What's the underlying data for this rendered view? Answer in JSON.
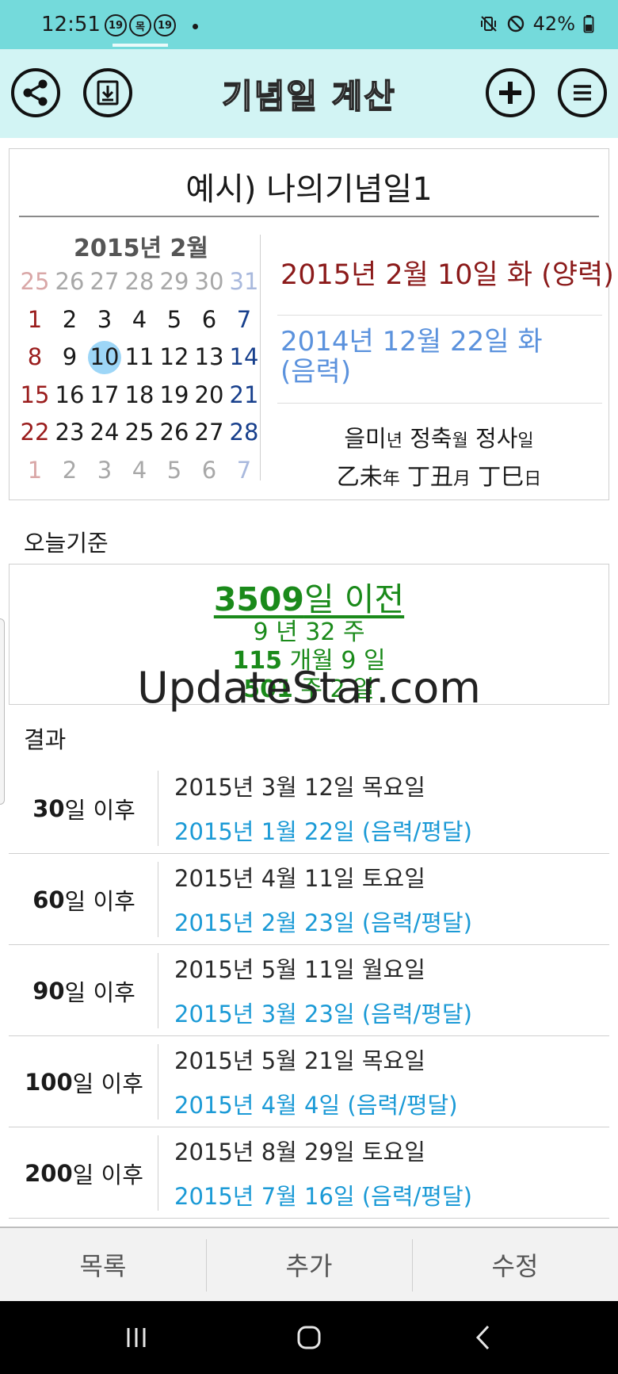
{
  "status_bar": {
    "time": "12:51",
    "badges": [
      "19",
      "목",
      "19"
    ],
    "battery": "42%"
  },
  "app_bar": {
    "title": "기념일 계산",
    "icons": [
      "share-icon",
      "download-icon",
      "add-icon",
      "menu-icon"
    ]
  },
  "anniversary": {
    "title": "예시) 나의기념일1",
    "calendar": {
      "month_label": "2015년 2월",
      "weeks": [
        [
          "25",
          "26",
          "27",
          "28",
          "29",
          "30",
          "31"
        ],
        [
          "1",
          "2",
          "3",
          "4",
          "5",
          "6",
          "7"
        ],
        [
          "8",
          "9",
          "10",
          "11",
          "12",
          "13",
          "14"
        ],
        [
          "15",
          "16",
          "17",
          "18",
          "19",
          "20",
          "21"
        ],
        [
          "22",
          "23",
          "24",
          "25",
          "26",
          "27",
          "28"
        ],
        [
          "1",
          "2",
          "3",
          "4",
          "5",
          "6",
          "7"
        ]
      ],
      "selected_day": "10"
    },
    "solar_date": "2015년 2월 10일 화 (양력)",
    "lunar_date": "2014년 12월 22일 화 (음력)",
    "ganji_korean": [
      {
        "value": "을미",
        "unit": "년"
      },
      {
        "value": "정축",
        "unit": "월"
      },
      {
        "value": "정사",
        "unit": "일"
      }
    ],
    "ganji_hanja": [
      {
        "value": "乙未",
        "unit": "年"
      },
      {
        "value": "丁丑",
        "unit": "月"
      },
      {
        "value": "丁巳",
        "unit": "日"
      }
    ]
  },
  "today": {
    "label": "오늘기준",
    "days_number": "3509",
    "days_suffix": "일 이전",
    "years_weeks": {
      "years": "9",
      "year_unit": " 년 ",
      "weeks": "32",
      "week_unit": " 주"
    },
    "months_days": {
      "months": "115",
      "month_unit": " 개월 ",
      "days": "9",
      "day_unit": " 일"
    },
    "weeks_days": {
      "weeks": "501",
      "week_unit": " 주 ",
      "days": "2",
      "day_unit": " 일"
    }
  },
  "watermark": "UpdateStar.com",
  "results": {
    "label": "결과",
    "items": [
      {
        "count": "30",
        "suffix": "일 이후",
        "solar": "2015년 3월 12일 목요일",
        "lunar": "2015년 1월 22일 (음력/평달)"
      },
      {
        "count": "60",
        "suffix": "일 이후",
        "solar": "2015년 4월 11일 토요일",
        "lunar": "2015년 2월 23일 (음력/평달)"
      },
      {
        "count": "90",
        "suffix": "일 이후",
        "solar": "2015년 5월 11일 월요일",
        "lunar": "2015년 3월 23일 (음력/평달)"
      },
      {
        "count": "100",
        "suffix": "일 이후",
        "solar": "2015년 5월 21일 목요일",
        "lunar": "2015년 4월 4일 (음력/평달)"
      },
      {
        "count": "200",
        "suffix": "일 이후",
        "solar": "2015년 8월 29일 토요일",
        "lunar": "2015년 7월 16일 (음력/평달)"
      }
    ]
  },
  "bottom_tabs": {
    "list": "목록",
    "add": "추가",
    "edit": "수정"
  },
  "colors": {
    "status_bar_bg": "#74dadb",
    "app_bar_bg": "#d2f4f4",
    "solar_date": "#8b1a1a",
    "lunar_date": "#5b92dd",
    "today_green": "#1a8a1a",
    "result_lunar": "#1b9ad6",
    "selected_day_bg": "#9dd6f7"
  }
}
